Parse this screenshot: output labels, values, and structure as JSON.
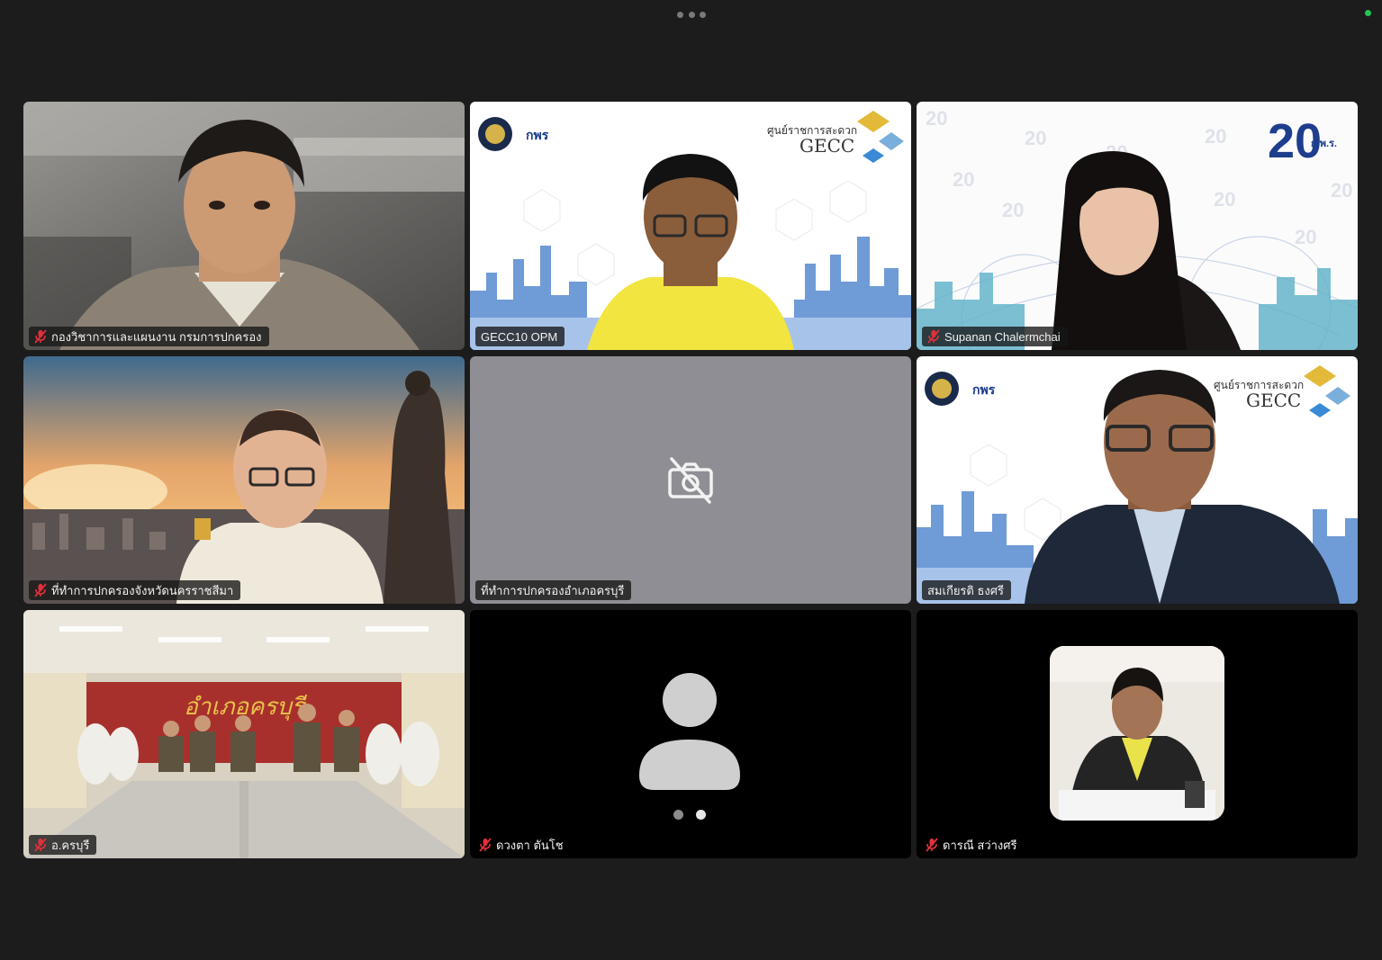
{
  "app": {
    "accent_active": "#23c552",
    "status_color": "#23c552",
    "muted_color": "#e0303a"
  },
  "tiles": [
    {
      "name": "กองวิชาการและแผนงาน กรมการปกครอง",
      "muted": true
    },
    {
      "name": "GECC10 OPM",
      "muted": false,
      "active": true
    },
    {
      "name": "Supanan Chalermchai",
      "muted": true
    },
    {
      "name": "ที่ทำการปกครองจังหวัดนครราชสีมา",
      "muted": true
    },
    {
      "name": "ที่ทำการปกครองอำเภอครบุรี",
      "muted": false,
      "camera": "off"
    },
    {
      "name": "สมเกียรติ ธงศรี",
      "muted": false
    },
    {
      "name": "อ.ครบุรี",
      "muted": true
    },
    {
      "name": "ดวงตา ตันโช",
      "muted": true,
      "camera": "avatar"
    },
    {
      "name": "ดารณี สว่างศรี",
      "muted": true
    }
  ],
  "backgrounds": {
    "gecc": {
      "brand": "GECC",
      "thai": "ศูนย์ราชการสะดวก",
      "org": "กพร"
    },
    "ocsc": {
      "number": "20",
      "suffix": "ก.พ.ร."
    },
    "hall": {
      "sign": "อำเภอครบุรี"
    }
  },
  "icons": {
    "menu": "more-horizontal-icon",
    "mic": "mic-muted-icon",
    "camera_off": "camera-off-icon",
    "avatar": "user-avatar-icon"
  }
}
